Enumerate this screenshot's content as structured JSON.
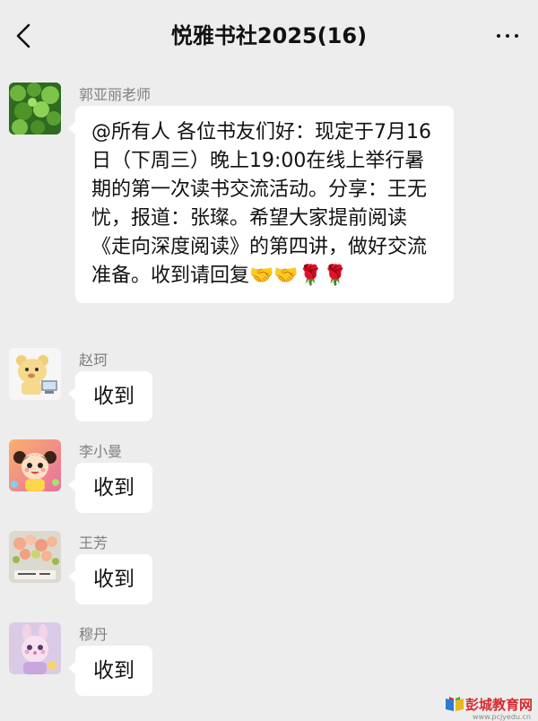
{
  "header": {
    "title": "悦雅书社2025(16)",
    "back_icon": "chevron-left-icon",
    "more_icon": "more-dots-icon"
  },
  "messages": [
    {
      "sender": "郭亚丽老师",
      "text": "@所有人 各位书友们好：现定于7月16日（下周三）晚上19:00在线上举行暑期的第一次读书交流活动。分享：王无忧，报道：张璨。希望大家提前阅读《走向深度阅读》的第四讲，做好交流准备。收到请回复🤝🤝🌹🌹",
      "avatar": "green-plant-avatar"
    },
    {
      "sender": "赵珂",
      "text": "收到",
      "avatar": "cartoon-bear-avatar"
    },
    {
      "sender": "李小曼",
      "text": "收到",
      "avatar": "cartoon-girl-avatar"
    },
    {
      "sender": "王芳",
      "text": "收到",
      "avatar": "flowers-avatar"
    },
    {
      "sender": "穆丹",
      "text": "收到",
      "avatar": "toy-bunny-avatar"
    }
  ],
  "watermark": {
    "text": "彭城教育网",
    "url": "www.pcjyedu.cn"
  }
}
